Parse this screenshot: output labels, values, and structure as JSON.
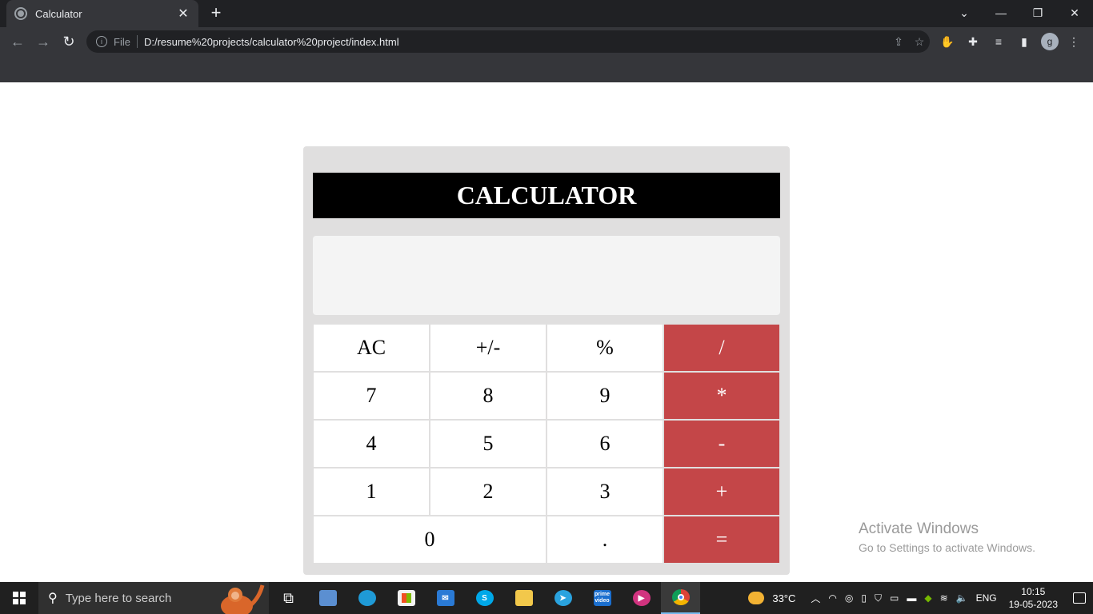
{
  "browser": {
    "tab_title": "Calculator",
    "tab_close": "✕",
    "new_tab": "+",
    "scheme_label": "File",
    "url": "D:/resume%20projects/calculator%20project/index.html",
    "profile_initial": "g"
  },
  "page": {
    "title": "CALCULATOR",
    "display_value": "",
    "keys": [
      {
        "label": "AC",
        "type": "function"
      },
      {
        "label": "+/-",
        "type": "function"
      },
      {
        "label": "%",
        "type": "function"
      },
      {
        "label": "/",
        "type": "operator"
      },
      {
        "label": "7",
        "type": "digit"
      },
      {
        "label": "8",
        "type": "digit"
      },
      {
        "label": "9",
        "type": "digit"
      },
      {
        "label": "*",
        "type": "operator"
      },
      {
        "label": "4",
        "type": "digit"
      },
      {
        "label": "5",
        "type": "digit"
      },
      {
        "label": "6",
        "type": "digit"
      },
      {
        "label": "-",
        "type": "operator"
      },
      {
        "label": "1",
        "type": "digit"
      },
      {
        "label": "2",
        "type": "digit"
      },
      {
        "label": "3",
        "type": "digit"
      },
      {
        "label": "+",
        "type": "operator"
      },
      {
        "label": "0",
        "type": "digit"
      },
      {
        "label": ".",
        "type": "digit"
      },
      {
        "label": "=",
        "type": "operator"
      }
    ],
    "operator_color": "#c44648"
  },
  "watermark": {
    "line1": "Activate Windows",
    "line2": "Go to Settings to activate Windows."
  },
  "taskbar": {
    "search_placeholder": "Type here to search",
    "weather": "33°C",
    "language": "ENG",
    "time": "10:15",
    "date": "19-05-2023",
    "prime_label": "prime video"
  }
}
